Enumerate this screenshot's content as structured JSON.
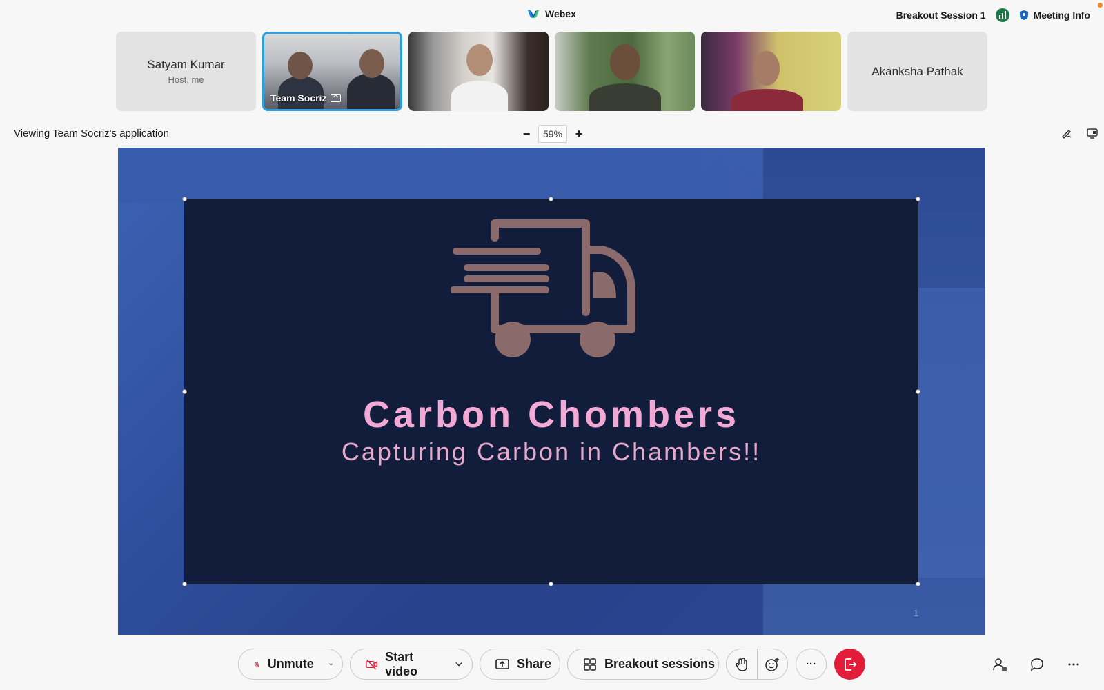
{
  "app": {
    "title": "Webex"
  },
  "header": {
    "breakout_session": "Breakout Session 1",
    "meeting_info": "Meeting Info"
  },
  "participants": [
    {
      "name": "Satyam Kumar",
      "subtitle": "Host, me",
      "video": false
    },
    {
      "name": "Team Socriz",
      "video": true,
      "sharing": true,
      "active": true
    },
    {
      "name": "",
      "video": true
    },
    {
      "name": "",
      "video": true
    },
    {
      "name": "",
      "video": true
    },
    {
      "name": "Akanksha Pathak",
      "video": false
    }
  ],
  "view": {
    "label": "Viewing Team Socriz's application",
    "zoom": "59%",
    "zoom_out": "−",
    "zoom_in": "+"
  },
  "slide": {
    "title": "Carbon Chombers",
    "subtitle": "Capturing Carbon in Chambers!!",
    "page_number": "1",
    "colors": {
      "background": "#111d3a",
      "title": "#f2a9d6",
      "logo": "#8a6a6a"
    }
  },
  "toolbar": {
    "unmute": "Unmute",
    "start_video": "Start video",
    "share": "Share",
    "breakout": "Breakout sessions",
    "more": "···"
  },
  "colors": {
    "accent": "#2aa0e0",
    "end_call": "#e21d3a",
    "status_green": "#1f7a4a",
    "notification": "#f08a24"
  }
}
